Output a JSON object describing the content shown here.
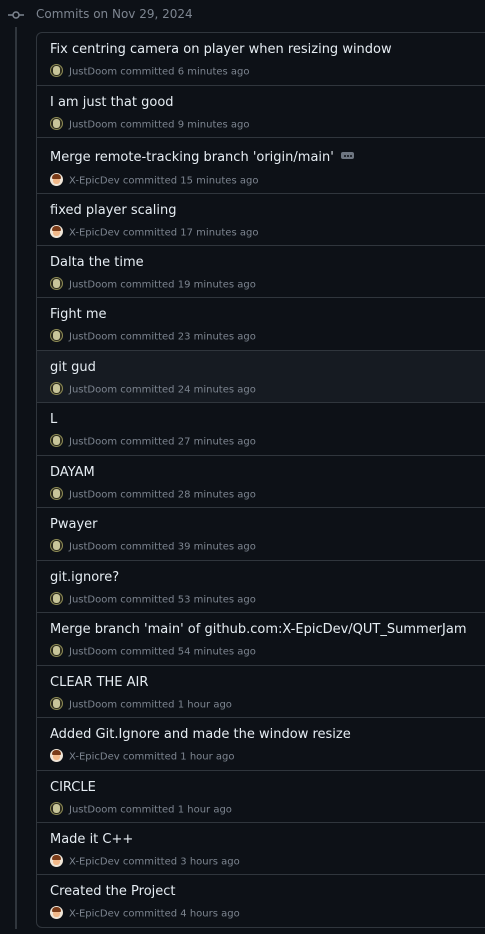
{
  "header": {
    "icon": "git-commit-icon",
    "date_label": "Commits on Nov 29, 2024"
  },
  "commits": [
    {
      "title": "Fix centring camera on player when resizing window",
      "author": "JustDoom",
      "action": "committed",
      "time": "6 minutes ago",
      "avatar": "justdoom-avatar"
    },
    {
      "title": "I am just that good",
      "author": "JustDoom",
      "action": "committed",
      "time": "9 minutes ago",
      "avatar": "justdoom-avatar"
    },
    {
      "title": "Merge remote-tracking branch 'origin/main'",
      "author": "X-EpicDev",
      "action": "committed",
      "time": "15 minutes ago",
      "avatar": "epicdev-avatar",
      "has_ellipsis": true
    },
    {
      "title": "fixed player scaling",
      "author": "X-EpicDev",
      "action": "committed",
      "time": "17 minutes ago",
      "avatar": "epicdev-avatar"
    },
    {
      "title": "Dalta the time",
      "author": "JustDoom",
      "action": "committed",
      "time": "19 minutes ago",
      "avatar": "justdoom-avatar"
    },
    {
      "title": "Fight me",
      "author": "JustDoom",
      "action": "committed",
      "time": "23 minutes ago",
      "avatar": "justdoom-avatar"
    },
    {
      "title": "git gud",
      "author": "JustDoom",
      "action": "committed",
      "time": "24 minutes ago",
      "avatar": "justdoom-avatar",
      "highlighted": true
    },
    {
      "title": "L",
      "author": "JustDoom",
      "action": "committed",
      "time": "27 minutes ago",
      "avatar": "justdoom-avatar"
    },
    {
      "title": "DAYAM",
      "author": "JustDoom",
      "action": "committed",
      "time": "28 minutes ago",
      "avatar": "justdoom-avatar"
    },
    {
      "title": "Pwayer",
      "author": "JustDoom",
      "action": "committed",
      "time": "39 minutes ago",
      "avatar": "justdoom-avatar"
    },
    {
      "title": "git.ignore?",
      "author": "JustDoom",
      "action": "committed",
      "time": "53 minutes ago",
      "avatar": "justdoom-avatar"
    },
    {
      "title": "Merge branch 'main' of github.com:X-EpicDev/QUT_SummerJam",
      "author": "JustDoom",
      "action": "committed",
      "time": "54 minutes ago",
      "avatar": "justdoom-avatar"
    },
    {
      "title": "CLEAR THE AIR",
      "author": "JustDoom",
      "action": "committed",
      "time": "1 hour ago",
      "avatar": "justdoom-avatar"
    },
    {
      "title": "Added Git.Ignore and made the window resize",
      "author": "X-EpicDev",
      "action": "committed",
      "time": "1 hour ago",
      "avatar": "epicdev-avatar"
    },
    {
      "title": "CIRCLE",
      "author": "JustDoom",
      "action": "committed",
      "time": "1 hour ago",
      "avatar": "justdoom-avatar"
    },
    {
      "title": "Made it C++",
      "author": "X-EpicDev",
      "action": "committed",
      "time": "3 hours ago",
      "avatar": "epicdev-avatar"
    },
    {
      "title": "Created the Project",
      "author": "X-EpicDev",
      "action": "committed",
      "time": "4 hours ago",
      "avatar": "epicdev-avatar"
    }
  ],
  "colors": {
    "background": "#0d1117",
    "border": "#30363d",
    "text_primary": "#e6edf3",
    "text_muted": "#7d8590",
    "row_highlight": "#161b22"
  }
}
